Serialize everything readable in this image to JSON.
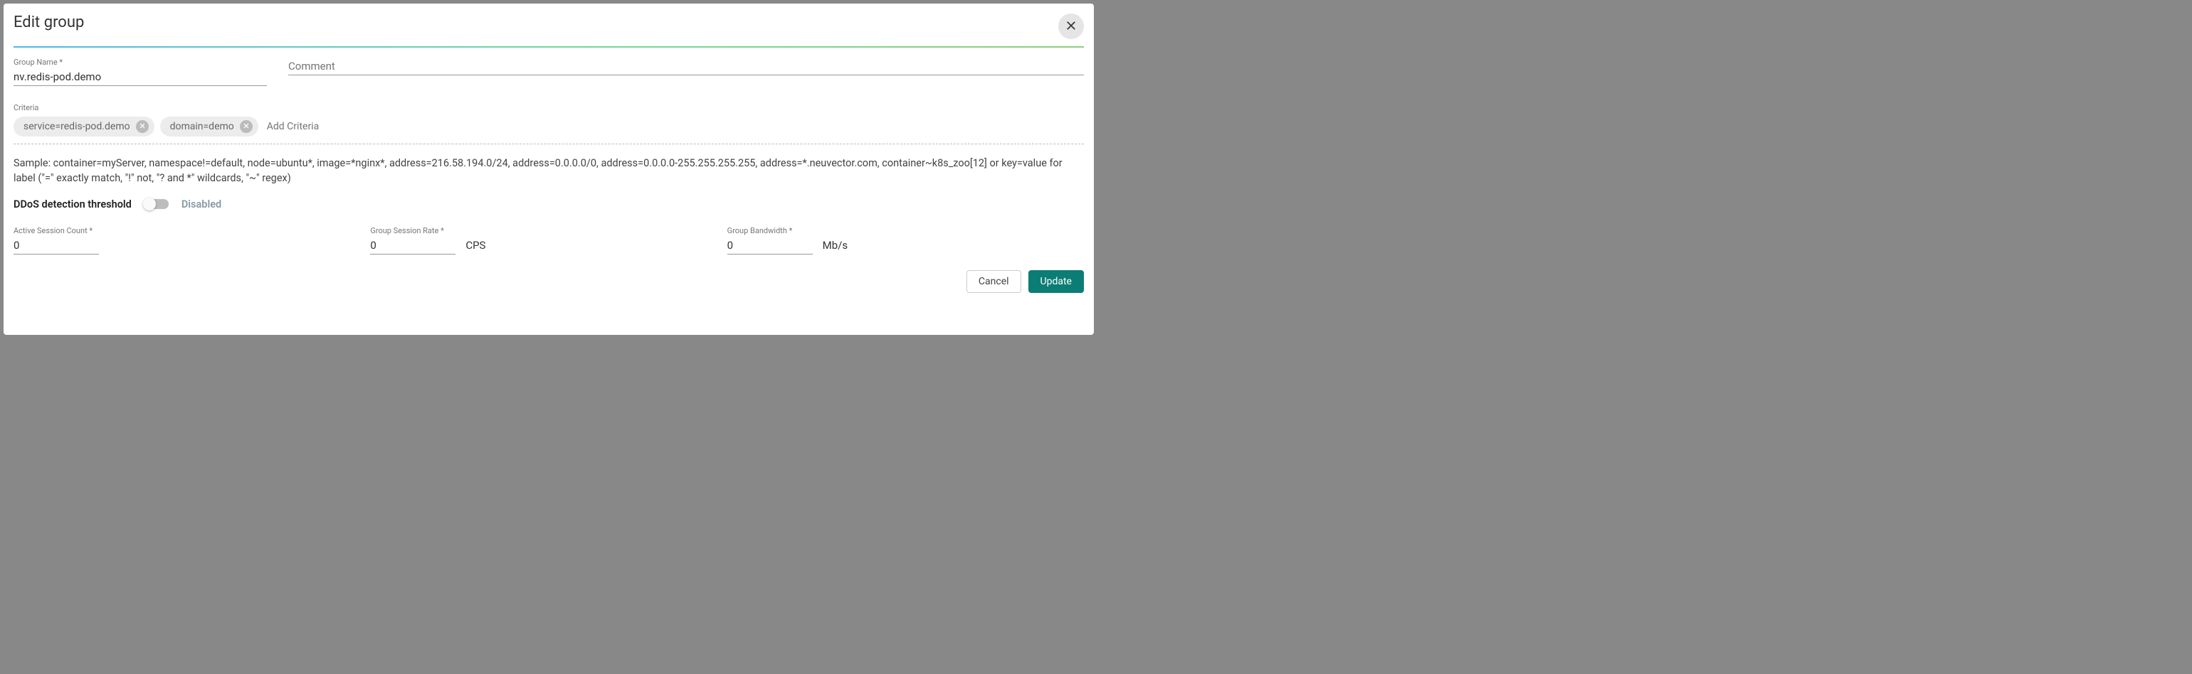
{
  "dialog": {
    "title": "Edit group"
  },
  "fields": {
    "group_name_label": "Group Name *",
    "group_name_value": "nv.redis-pod.demo",
    "comment_label": "Comment",
    "comment_value": ""
  },
  "criteria": {
    "label": "Criteria",
    "chips": [
      "service=redis-pod.demo",
      "domain=demo"
    ],
    "add_placeholder": "Add Criteria"
  },
  "sample_text": "Sample: container=myServer, namespace!=default, node=ubuntu*, image=*nginx*, address=216.58.194.0/24, address=0.0.0.0/0, address=0.0.0.0-255.255.255.255, address=*.neuvector.com, container~k8s_zoo[12] or key=value for label (\"=\" exactly match, \"!\" not, \"? and *\" wildcards, \"~\" regex)",
  "ddos": {
    "label": "DDoS detection threshold",
    "state": "Disabled"
  },
  "metrics": {
    "active_session_label": "Active Session Count *",
    "active_session_value": "0",
    "group_session_rate_label": "Group Session Rate *",
    "group_session_rate_value": "0",
    "group_session_rate_unit": "CPS",
    "group_bandwidth_label": "Group Bandwidth *",
    "group_bandwidth_value": "0",
    "group_bandwidth_unit": "Mb/s"
  },
  "buttons": {
    "cancel": "Cancel",
    "update": "Update"
  }
}
